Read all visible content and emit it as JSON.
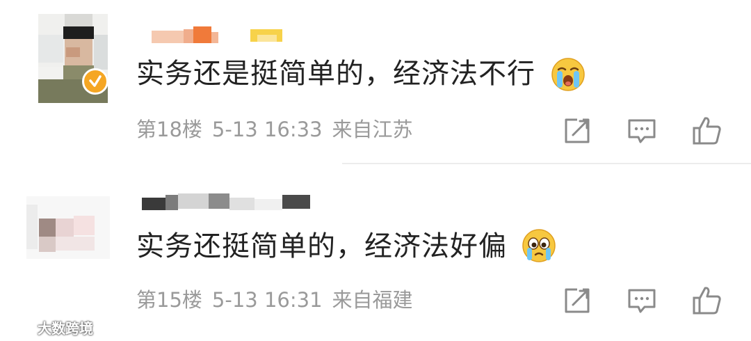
{
  "comments": [
    {
      "text": "实务还是挺简单的，经济法不行",
      "emoji": "crying-emoji",
      "floor": "第18楼",
      "time": "5-13 16:33",
      "location": "来自江苏",
      "verified": true
    },
    {
      "text": "实务还挺简单的，经济法好偏",
      "emoji": "teary-eyes-emoji",
      "floor": "第15楼",
      "time": "5-13 16:31",
      "location": "来自福建",
      "verified": false
    }
  ],
  "actions": {
    "repost_icon": "repost-icon",
    "reply_icon": "comment-icon",
    "like_icon": "thumbs-up-icon"
  },
  "colors": {
    "text": "#222222",
    "meta": "#9a9a9a",
    "badge": "#f5a623",
    "icon": "#8a8a8a"
  },
  "watermark": {
    "text": "大数跨境"
  }
}
